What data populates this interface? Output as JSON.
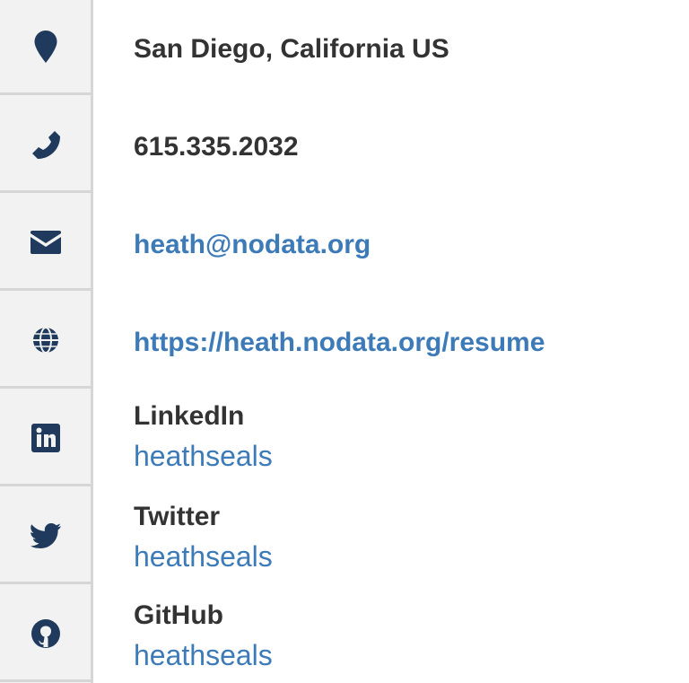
{
  "contact": {
    "location": "San Diego, California US",
    "phone": "615.335.2032",
    "email": "heath@nodata.org",
    "website": "https://heath.nodata.org/resume"
  },
  "social": [
    {
      "network": "LinkedIn",
      "username": "heathseals"
    },
    {
      "network": "Twitter",
      "username": "heathseals"
    },
    {
      "network": "GitHub",
      "username": "heathseals"
    }
  ],
  "icons": [
    "map-marker-icon",
    "phone-icon",
    "envelope-icon",
    "globe-icon",
    "linkedin-icon",
    "twitter-icon",
    "github-icon"
  ],
  "colors": {
    "text": "#333333",
    "link": "#3d7ab8",
    "icon": "#1f3a5c",
    "rail": "#f2f2f2",
    "border": "#d6d6d6"
  }
}
